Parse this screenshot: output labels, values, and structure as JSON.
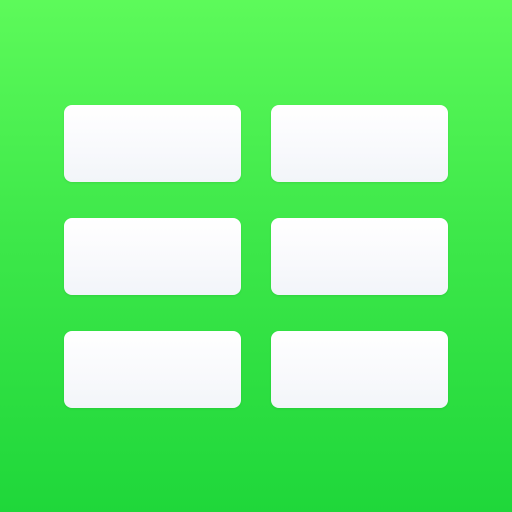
{
  "icon": {
    "name": "grid-icon",
    "background_top": "#5dfa5a",
    "background_bottom": "#1fd73a",
    "tile_color": "#ffffff",
    "tiles": [
      {
        "row": 1,
        "col": 1
      },
      {
        "row": 1,
        "col": 2
      },
      {
        "row": 2,
        "col": 1
      },
      {
        "row": 2,
        "col": 2
      },
      {
        "row": 3,
        "col": 1
      },
      {
        "row": 3,
        "col": 2
      }
    ]
  }
}
